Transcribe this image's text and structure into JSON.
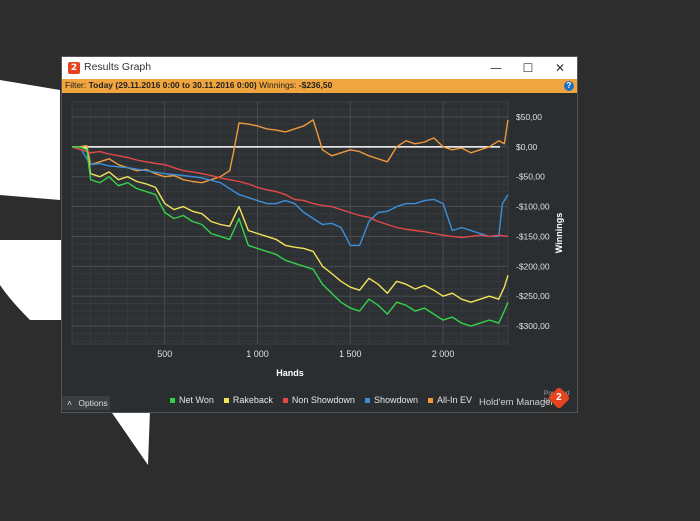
{
  "window": {
    "title": "Results Graph",
    "app_icon_text": "2",
    "controls": {
      "minimize": "—",
      "maximize": "☐",
      "close": "✕"
    }
  },
  "filter": {
    "label": "Filter:",
    "range": "Today (29.11.2016 0:00 to 30.11.2016 0:00)",
    "winnings_label": "Winnings:",
    "winnings_value": "-$236,50",
    "help_icon": "?"
  },
  "options_label": "Options",
  "options_chevron": "˄",
  "powered_by": "Powered by",
  "brand_name": "Hold'em Manager",
  "brand_logo_text": "2",
  "colors": {
    "net_won": "#35d14a",
    "rakeback": "#f2e35a",
    "non_showdown": "#e34848",
    "showdown": "#3b8fd8",
    "all_in_ev": "#ee9a3a",
    "zero_line": "#ffffff"
  },
  "chart_data": {
    "type": "line",
    "xlabel": "Hands",
    "ylabel": "Winnings",
    "xlim": [
      0,
      2350
    ],
    "ylim": [
      -330,
      75
    ],
    "xticks": [
      500,
      1000,
      1500,
      2000
    ],
    "xtick_labels": [
      "500",
      "1 000",
      "1 500",
      "2 000"
    ],
    "yticks": [
      50,
      0,
      -50,
      -100,
      -150,
      -200,
      -250,
      -300
    ],
    "ytick_labels": [
      "$50,00",
      "$0,00",
      "-$50,00",
      "-$100,00",
      "-$150,00",
      "-$200,00",
      "-$250,00",
      "-$300,00"
    ],
    "grid": true,
    "legend_position": "bottom",
    "series": [
      {
        "name": "Net Won",
        "key": "net_won",
        "x": [
          0,
          40,
          80,
          100,
          150,
          200,
          250,
          300,
          350,
          400,
          450,
          500,
          550,
          600,
          650,
          700,
          750,
          800,
          850,
          900,
          950,
          1000,
          1050,
          1100,
          1150,
          1200,
          1250,
          1300,
          1350,
          1400,
          1450,
          1500,
          1550,
          1600,
          1650,
          1700,
          1750,
          1800,
          1850,
          1900,
          1950,
          2000,
          2050,
          2100,
          2150,
          2200,
          2250,
          2300,
          2330,
          2350
        ],
        "y": [
          0,
          0,
          -5,
          -55,
          -60,
          -50,
          -65,
          -60,
          -70,
          -75,
          -80,
          -110,
          -120,
          -115,
          -125,
          -130,
          -145,
          -150,
          -155,
          -120,
          -165,
          -170,
          -175,
          -180,
          -190,
          -195,
          -200,
          -205,
          -230,
          -245,
          -260,
          -270,
          -275,
          -255,
          -265,
          -280,
          -260,
          -265,
          -275,
          -270,
          -280,
          -290,
          -285,
          -295,
          -300,
          -295,
          -290,
          -295,
          -275,
          -260
        ]
      },
      {
        "name": "Rakeback",
        "key": "rakeback",
        "x": [
          0,
          40,
          80,
          100,
          150,
          200,
          250,
          300,
          350,
          400,
          450,
          500,
          550,
          600,
          650,
          700,
          750,
          800,
          850,
          900,
          950,
          1000,
          1050,
          1100,
          1150,
          1200,
          1250,
          1300,
          1350,
          1400,
          1450,
          1500,
          1550,
          1600,
          1650,
          1700,
          1750,
          1800,
          1850,
          1900,
          1950,
          2000,
          2050,
          2100,
          2150,
          2200,
          2250,
          2300,
          2330,
          2350
        ],
        "y": [
          0,
          0,
          -3,
          -45,
          -50,
          -42,
          -55,
          -50,
          -58,
          -62,
          -68,
          -95,
          -105,
          -100,
          -108,
          -112,
          -125,
          -130,
          -133,
          -100,
          -140,
          -145,
          -150,
          -155,
          -165,
          -168,
          -170,
          -175,
          -200,
          -212,
          -225,
          -235,
          -240,
          -220,
          -230,
          -245,
          -225,
          -230,
          -238,
          -232,
          -240,
          -250,
          -245,
          -255,
          -260,
          -255,
          -250,
          -255,
          -235,
          -215
        ]
      },
      {
        "name": "Non Showdown",
        "key": "non_showdown",
        "x": [
          0,
          50,
          100,
          150,
          200,
          250,
          300,
          350,
          400,
          450,
          500,
          550,
          600,
          650,
          700,
          750,
          800,
          850,
          900,
          950,
          1000,
          1050,
          1100,
          1150,
          1200,
          1250,
          1300,
          1350,
          1400,
          1450,
          1500,
          1550,
          1600,
          1650,
          1700,
          1750,
          1800,
          1850,
          1900,
          1950,
          2000,
          2050,
          2100,
          2150,
          2200,
          2250,
          2300,
          2350
        ],
        "y": [
          0,
          -5,
          -10,
          -8,
          -12,
          -15,
          -18,
          -22,
          -25,
          -28,
          -30,
          -35,
          -40,
          -42,
          -45,
          -48,
          -52,
          -55,
          -58,
          -62,
          -68,
          -72,
          -75,
          -80,
          -88,
          -90,
          -95,
          -98,
          -100,
          -105,
          -110,
          -115,
          -118,
          -125,
          -130,
          -135,
          -138,
          -140,
          -142,
          -145,
          -148,
          -150,
          -152,
          -150,
          -148,
          -150,
          -148,
          -150
        ]
      },
      {
        "name": "Showdown",
        "key": "showdown",
        "x": [
          0,
          50,
          100,
          150,
          200,
          300,
          400,
          500,
          600,
          700,
          800,
          850,
          900,
          950,
          1000,
          1050,
          1100,
          1150,
          1200,
          1250,
          1300,
          1350,
          1400,
          1450,
          1500,
          1550,
          1600,
          1650,
          1700,
          1750,
          1800,
          1850,
          1900,
          1950,
          2000,
          2050,
          2100,
          2150,
          2200,
          2250,
          2300,
          2320,
          2350
        ],
        "y": [
          0,
          -5,
          -30,
          -28,
          -32,
          -35,
          -40,
          -45,
          -48,
          -52,
          -60,
          -70,
          -80,
          -85,
          -90,
          -95,
          -95,
          -90,
          -95,
          -110,
          -120,
          -130,
          -128,
          -135,
          -165,
          -165,
          -125,
          -110,
          -108,
          -100,
          -95,
          -95,
          -90,
          -88,
          -95,
          -140,
          -135,
          -140,
          -145,
          -150,
          -150,
          -95,
          -80
        ]
      },
      {
        "name": "All-In EV",
        "key": "all_in_ev",
        "x": [
          0,
          40,
          80,
          100,
          150,
          200,
          250,
          300,
          350,
          400,
          450,
          500,
          550,
          600,
          650,
          700,
          750,
          800,
          850,
          870,
          900,
          950,
          1000,
          1050,
          1100,
          1150,
          1200,
          1250,
          1300,
          1350,
          1400,
          1450,
          1500,
          1550,
          1600,
          1650,
          1700,
          1750,
          1800,
          1850,
          1900,
          1950,
          2000,
          2050,
          2100,
          2150,
          2200,
          2250,
          2300,
          2330,
          2350
        ],
        "y": [
          0,
          0,
          2,
          -30,
          -25,
          -20,
          -30,
          -35,
          -40,
          -38,
          -45,
          -50,
          -48,
          -55,
          -58,
          -60,
          -55,
          -50,
          -40,
          -10,
          40,
          38,
          35,
          30,
          28,
          25,
          30,
          35,
          45,
          -5,
          -15,
          -10,
          -5,
          -8,
          -15,
          -20,
          -25,
          0,
          10,
          5,
          8,
          15,
          0,
          -5,
          -2,
          -10,
          -5,
          0,
          10,
          5,
          45
        ]
      }
    ]
  }
}
